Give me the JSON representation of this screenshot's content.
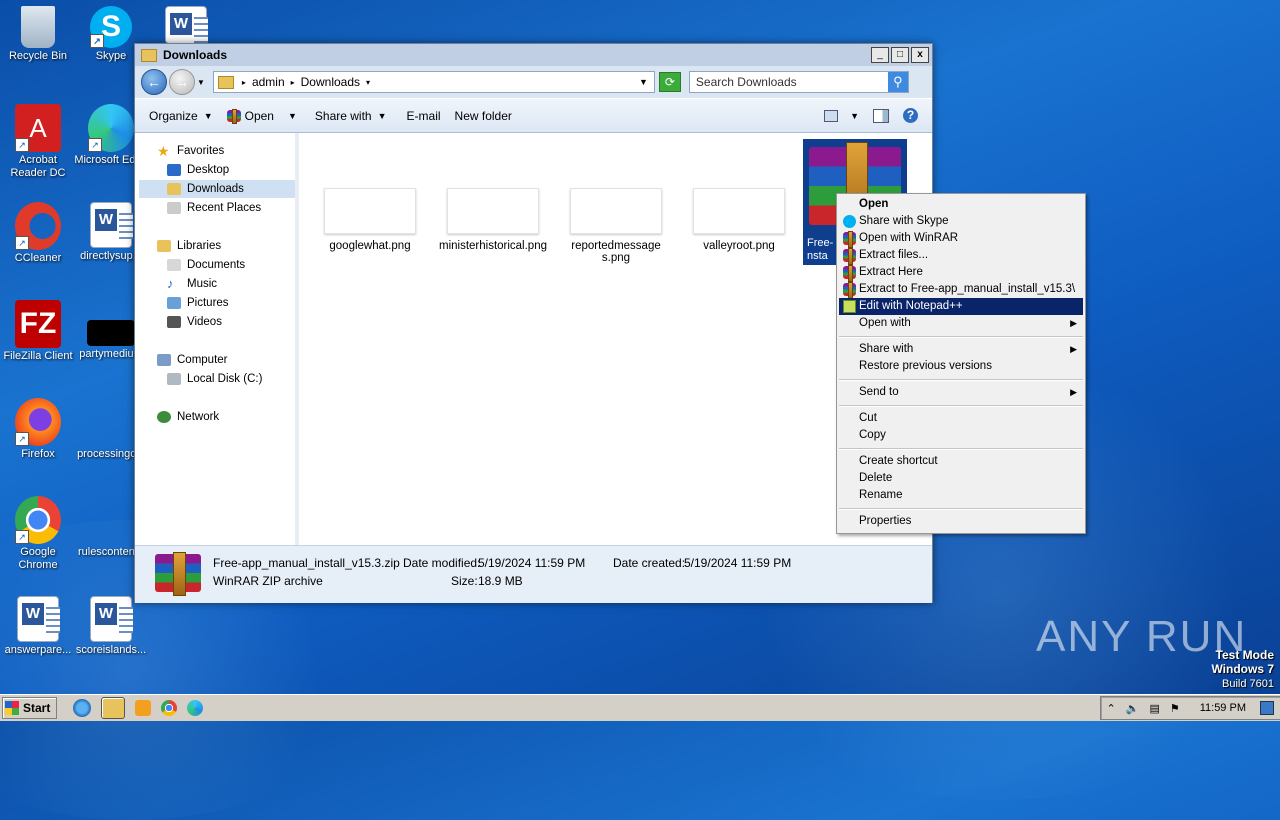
{
  "desktop": {
    "icons": [
      {
        "label": "Recycle Bin"
      },
      {
        "label": "Skype"
      },
      {
        "label": "Acrobat Reader DC"
      },
      {
        "label": "Microsoft Edge"
      },
      {
        "label": "CCleaner"
      },
      {
        "label": "directlysup..."
      },
      {
        "label": "FileZilla Client"
      },
      {
        "label": "partymediu..."
      },
      {
        "label": "Firefox"
      },
      {
        "label": "processingc..."
      },
      {
        "label": "Google Chrome"
      },
      {
        "label": "rulesconten..."
      },
      {
        "label": "answerpare..."
      },
      {
        "label": "scoreislands..."
      }
    ]
  },
  "window": {
    "title": "Downloads",
    "min": "_",
    "max": "□",
    "close": "x",
    "breadcrumb": [
      "admin",
      "Downloads"
    ],
    "search_placeholder": "Search Downloads",
    "toolbar": {
      "organize": "Organize",
      "open": "Open",
      "share_with": "Share with",
      "email": "E-mail",
      "new_folder": "New folder"
    }
  },
  "navpane": {
    "favorites": "Favorites",
    "desktop": "Desktop",
    "downloads": "Downloads",
    "recent": "Recent Places",
    "libraries": "Libraries",
    "documents": "Documents",
    "music": "Music",
    "pictures": "Pictures",
    "videos": "Videos",
    "computer": "Computer",
    "localdisk": "Local Disk (C:)",
    "network": "Network"
  },
  "files": [
    {
      "name": "googlewhat.png"
    },
    {
      "name": "ministerhistorical.png"
    },
    {
      "name": "reportedmessages.png"
    },
    {
      "name": "valleyroot.png"
    },
    {
      "name": "Free-app_manual_install_v15.3.zip",
      "visible_label": "Free-\nnsta"
    }
  ],
  "details": {
    "filename": "Free-app_manual_install_v15.3.zip",
    "type": "WinRAR ZIP archive",
    "modified_label": "Date modified:",
    "modified": "5/19/2024 11:59 PM",
    "created_label": "Date created:",
    "created": "5/19/2024 11:59 PM",
    "size_label": "Size:",
    "size": "18.9 MB"
  },
  "context_menu": {
    "open": "Open",
    "share_skype": "Share with Skype",
    "open_winrar": "Open with WinRAR",
    "extract_files": "Extract files...",
    "extract_here": "Extract Here",
    "extract_to": "Extract to Free-app_manual_install_v15.3\\",
    "edit_notepad": "Edit with Notepad++",
    "open_with": "Open with",
    "share_with": "Share with",
    "restore": "Restore previous versions",
    "send_to": "Send to",
    "cut": "Cut",
    "copy": "Copy",
    "create_shortcut": "Create shortcut",
    "delete": "Delete",
    "rename": "Rename",
    "properties": "Properties"
  },
  "taskbar": {
    "start": "Start",
    "clock": "11:59 PM"
  },
  "watermark": {
    "brand": "ANY RUN",
    "line1": "Test Mode",
    "line2": "Windows 7",
    "line3": "Build 7601"
  }
}
